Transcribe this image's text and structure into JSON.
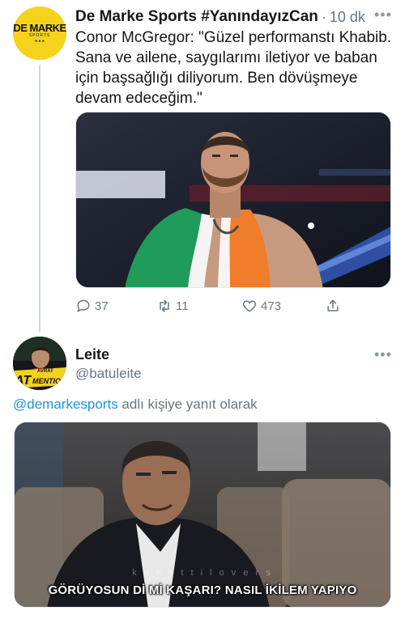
{
  "tweet": {
    "author_name": "De Marke Sports #YanındayızCan",
    "separator": "·",
    "time": "10 dk",
    "avatar_logo": "DE MARKE",
    "avatar_sub": "SPORTS",
    "avatar_dots": "● ● ●",
    "text": "Conor McGregor: \"Güzel performanstı Khabib. Sana ve ailene, saygılarımı iletiyor ve baban için başsağlığı diliyorum. Ben dövüşmeye devam edeceğim.\"",
    "media_icon": "photo-fighter-with-flag",
    "actions": {
      "reply_count": "37",
      "retweet_count": "11",
      "like_count": "473"
    }
  },
  "reply": {
    "author_name": "Leite",
    "handle": "@batuleite",
    "avatar_badge_line1": "AVRAT",
    "avatar_badge_line2": "AT",
    "avatar_badge_line3": "MENTION",
    "replying_to_mention": "@demarkesports",
    "replying_to_suffix": " adlı kişiye yanıt olarak",
    "media_watermark": "k a n e t t i l o v e r s",
    "media_subtitle": "GÖRÜYOSUN Dİ Mİ KAŞARI? NASIL İKİLEM YAPIYO"
  },
  "colors": {
    "link": "#1b95e0",
    "secondary_text": "#657786",
    "avatar_yellow": "#f5d21c",
    "badge_yellow": "#f2d21f"
  }
}
